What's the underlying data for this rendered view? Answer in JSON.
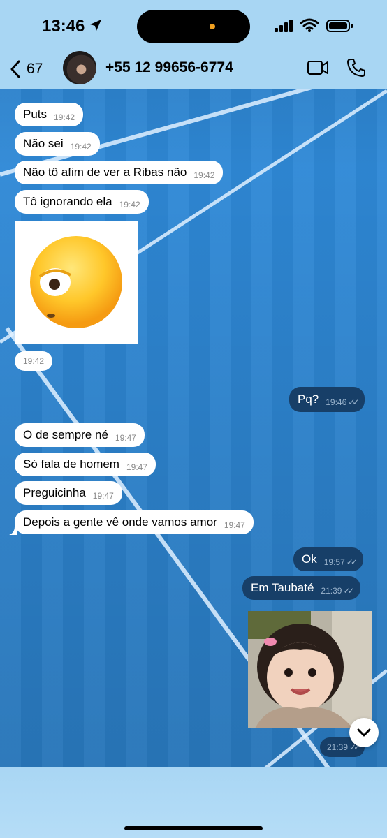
{
  "status_bar": {
    "time": "13:46"
  },
  "header": {
    "back_count": "67",
    "contact": "+55 12 99656-6774"
  },
  "messages_in_top": [
    {
      "text": "Puts",
      "time": "19:42"
    },
    {
      "text": "Não sei",
      "time": "19:42"
    },
    {
      "text": "Não tô afim de ver a Ribas não",
      "time": "19:42"
    },
    {
      "text": "Tô ignorando ela",
      "time": "19:42"
    }
  ],
  "sticker_time": "19:42",
  "message_out_pq": {
    "text": "Pq?",
    "time": "19:46"
  },
  "messages_in_bottom": [
    {
      "text": "O de sempre né",
      "time": "19:47"
    },
    {
      "text": "Só fala de homem",
      "time": "19:47"
    },
    {
      "text": "Preguicinha",
      "time": "19:47"
    },
    {
      "text": "Depois a gente vê onde vamos amor",
      "time": "19:47"
    }
  ],
  "messages_out_bottom": [
    {
      "text": "Ok",
      "time": "19:57"
    },
    {
      "text": "Em Taubaté",
      "time": "21:39"
    }
  ],
  "photo_time": "21:39",
  "colors": {
    "incoming_bubble": "#ffffff",
    "outgoing_bubble": "#173f68",
    "header_bg": "#a8d6f3",
    "wallpaper": "#2e88d6"
  }
}
